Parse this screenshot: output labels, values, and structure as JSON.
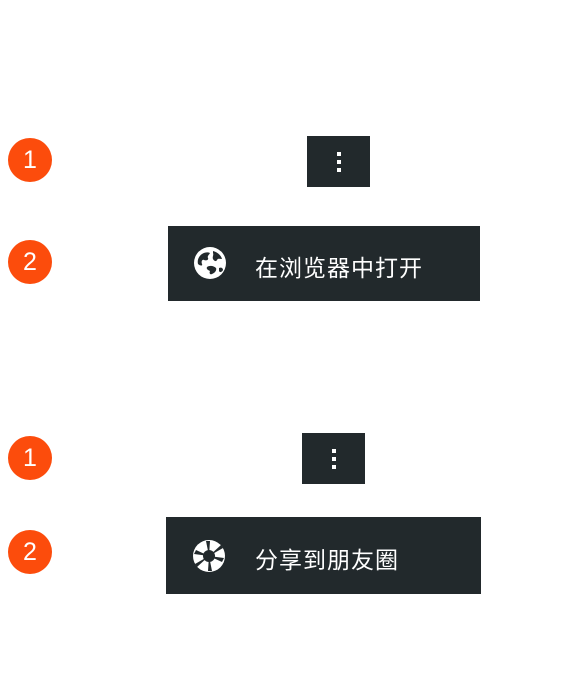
{
  "colors": {
    "badge": "#fc4c0c",
    "menu_background": "#22292c",
    "text": "#ffffff"
  },
  "section_open_in_browser": {
    "steps": [
      {
        "number": "1"
      },
      {
        "number": "2"
      }
    ],
    "more_button": {
      "icon": "more-vertical-icon"
    },
    "menu_item": {
      "icon": "globe-icon",
      "label": "在浏览器中打开"
    }
  },
  "section_share_moments": {
    "steps": [
      {
        "number": "1"
      },
      {
        "number": "2"
      }
    ],
    "more_button": {
      "icon": "more-vertical-icon"
    },
    "menu_item": {
      "icon": "camera-shutter-icon",
      "label": "分享到朋友圈"
    }
  }
}
